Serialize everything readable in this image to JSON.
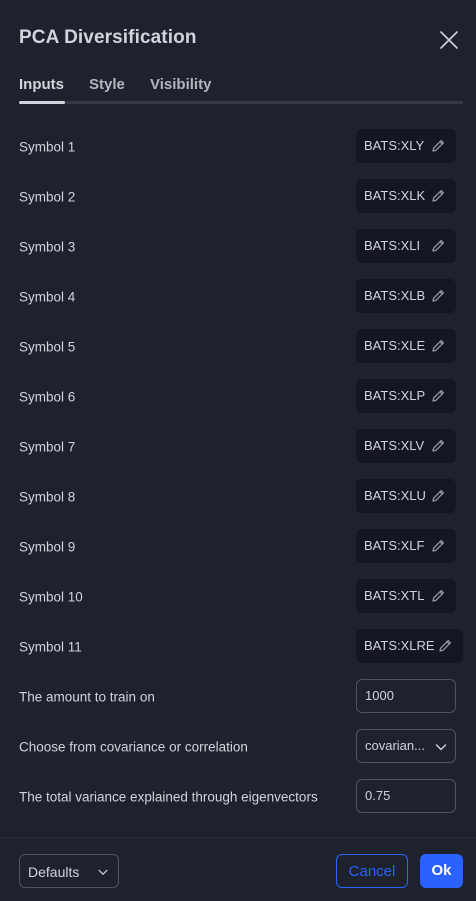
{
  "dialog": {
    "title": "PCA Diversification"
  },
  "tabs": [
    {
      "label": "Inputs",
      "active": true
    },
    {
      "label": "Style",
      "active": false
    },
    {
      "label": "Visibility",
      "active": false
    }
  ],
  "symbols": [
    {
      "label": "Symbol 1",
      "value": "BATS:XLY"
    },
    {
      "label": "Symbol 2",
      "value": "BATS:XLK"
    },
    {
      "label": "Symbol 3",
      "value": "BATS:XLI"
    },
    {
      "label": "Symbol 4",
      "value": "BATS:XLB"
    },
    {
      "label": "Symbol 5",
      "value": "BATS:XLE"
    },
    {
      "label": "Symbol 6",
      "value": "BATS:XLP"
    },
    {
      "label": "Symbol 7",
      "value": "BATS:XLV"
    },
    {
      "label": "Symbol 8",
      "value": "BATS:XLU"
    },
    {
      "label": "Symbol 9",
      "value": "BATS:XLF"
    },
    {
      "label": "Symbol 10",
      "value": "BATS:XTL"
    },
    {
      "label": "Symbol 11",
      "value": "BATS:XLRE"
    }
  ],
  "train": {
    "label": "The amount to train on",
    "value": "1000"
  },
  "method": {
    "label": "Choose from covariance or correlation",
    "value": "covarian..."
  },
  "variance": {
    "label": "The total variance explained through eigenvectors",
    "value": "0.75"
  },
  "footer": {
    "defaults_label": "Defaults",
    "cancel_label": "Cancel",
    "ok_label": "Ok"
  },
  "colors": {
    "background": "#1e222d",
    "field_bg": "#131722",
    "accent": "#2962ff",
    "text": "#d1d4dc"
  },
  "icons": {
    "close": "close-icon",
    "edit": "pencil-icon",
    "dropdown": "chevron-down-icon"
  }
}
